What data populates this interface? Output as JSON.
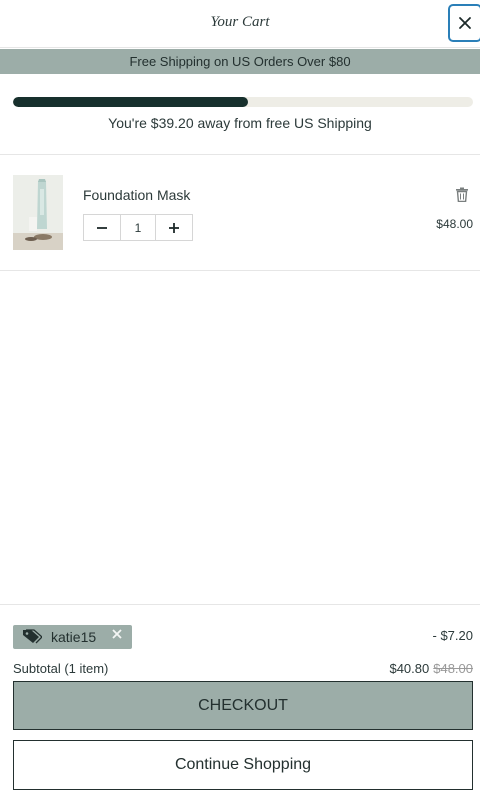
{
  "header": {
    "title": "Your Cart"
  },
  "announcement": "Free Shipping on US Orders Over $80",
  "shipping_progress": {
    "fraction": 0.51,
    "message": "You're $39.20 away from free US Shipping"
  },
  "cart_items": [
    {
      "name": "Foundation Mask",
      "quantity": "1",
      "price": "$48.00"
    }
  ],
  "discount": {
    "code": "katie15",
    "amount": "- $7.20"
  },
  "subtotal": {
    "label": "Subtotal (1 item)",
    "value": "$40.80",
    "original": "$48.00"
  },
  "actions": {
    "checkout_label": "CHECKOUT",
    "continue_label": "Continue Shopping"
  },
  "icons": {
    "close": "close-icon",
    "trash": "trash-icon",
    "tag": "tag-icon",
    "minus": "minus-icon",
    "plus": "plus-icon"
  },
  "colors": {
    "accent": "#9cada8",
    "progress_fill": "#17302d",
    "progress_track": "#eeede6",
    "focus_ring": "#2a7fb8"
  }
}
